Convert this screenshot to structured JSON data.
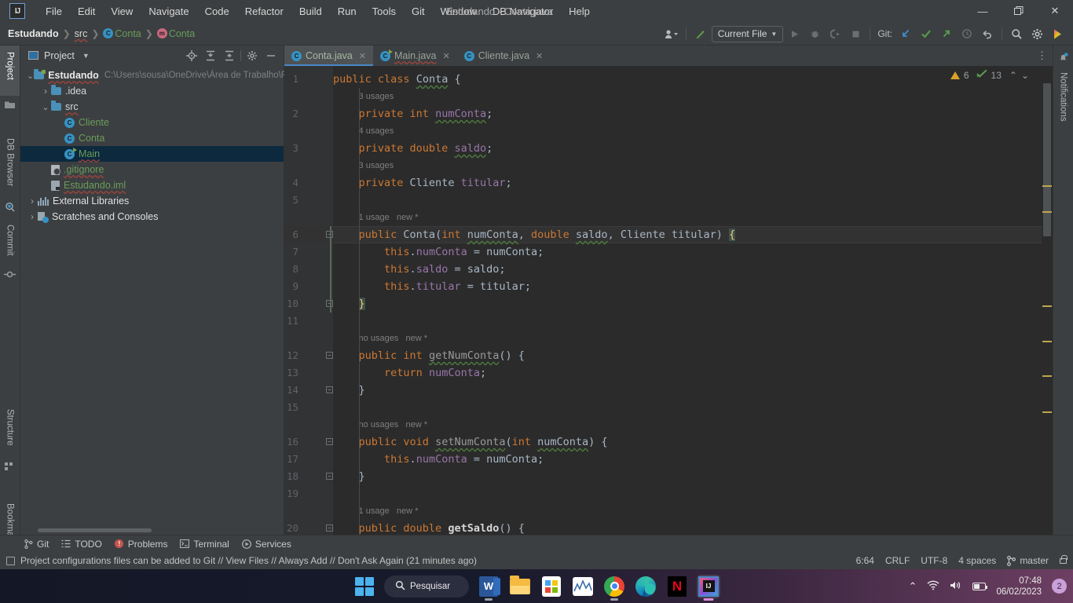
{
  "window": {
    "title": "Estudando - Conta.java",
    "minimize": "—",
    "maximize": "❐",
    "close": "✕"
  },
  "menubar": [
    {
      "label": "File"
    },
    {
      "label": "Edit"
    },
    {
      "label": "View"
    },
    {
      "label": "Navigate"
    },
    {
      "label": "Code"
    },
    {
      "label": "Refactor"
    },
    {
      "label": "Build"
    },
    {
      "label": "Run"
    },
    {
      "label": "Tools"
    },
    {
      "label": "Git"
    },
    {
      "label": "Window"
    },
    {
      "label": "DB Navigator"
    },
    {
      "label": "Help"
    }
  ],
  "breadcrumb": [
    {
      "label": "Estudando",
      "icon": "none"
    },
    {
      "label": "src",
      "icon": "none"
    },
    {
      "label": "Conta",
      "icon": "class-icon"
    },
    {
      "label": "Conta",
      "icon": "method-icon"
    }
  ],
  "toolbar": {
    "profile_icon": "user-icon",
    "hammer_icon": "build-icon",
    "run_config": "Current File",
    "run_icon": "run-icon",
    "debug_icon": "debug-icon",
    "coverage_icon": "run-coverage-icon",
    "stop_icon": "stop-icon",
    "git_label": "Git:",
    "update_icon": "update-project-icon",
    "commit_icon": "commit-checkmark-icon",
    "push_icon": "push-icon",
    "history_icon": "history-icon",
    "rollback_icon": "rollback-icon",
    "search_icon": "search-everywhere-icon",
    "settings_icon": "gear-icon",
    "ai_icon": "ai-assistant-icon"
  },
  "left_stripe": [
    {
      "label": "Project",
      "icon": "project-icon",
      "active": true
    },
    {
      "label": "DB Browser",
      "icon": "db-browser-icon",
      "active": false
    },
    {
      "label": "Commit",
      "icon": "commit-icon",
      "active": false
    },
    {
      "label": "Structure",
      "icon": "structure-icon",
      "active": false
    },
    {
      "label": "Bookmarks",
      "icon": "bookmark-icon",
      "active": false
    }
  ],
  "right_stripe": [
    {
      "label": "Notifications",
      "icon": "bell-icon"
    }
  ],
  "project_panel": {
    "title": "Project",
    "tools": [
      "locate-icon",
      "expand-all-icon",
      "collapse-all-icon",
      "gear-icon",
      "hide-icon"
    ],
    "tree": [
      {
        "label": "Estudando",
        "path": "C:\\Users\\sousa\\OneDrive\\Área de Trabalho\\F",
        "icon": "project-folder-icon",
        "indent": 0,
        "arrow": "down",
        "style": "bold",
        "selected": false
      },
      {
        "label": ".idea",
        "path": "",
        "icon": "folder-icon",
        "indent": 1,
        "arrow": "right",
        "style": "plain",
        "selected": false
      },
      {
        "label": "src",
        "path": "",
        "icon": "folder-icon",
        "indent": 1,
        "arrow": "down",
        "style": "plain",
        "selected": false
      },
      {
        "label": "Cliente",
        "path": "",
        "icon": "java-class-icon",
        "indent": 2,
        "arrow": "none",
        "style": "green",
        "selected": false
      },
      {
        "label": "Conta",
        "path": "",
        "icon": "java-class-icon",
        "indent": 2,
        "arrow": "none",
        "style": "green",
        "selected": false
      },
      {
        "label": "Main",
        "path": "",
        "icon": "java-runnable-class-icon",
        "indent": 2,
        "arrow": "none",
        "style": "green",
        "selected": true
      },
      {
        "label": ".gitignore",
        "path": "",
        "icon": "gitignore-file-icon",
        "indent": 1,
        "arrow": "none",
        "style": "green",
        "selected": false
      },
      {
        "label": "Estudando.iml",
        "path": "",
        "icon": "iml-file-icon",
        "indent": 1,
        "arrow": "none",
        "style": "green",
        "selected": false
      },
      {
        "label": "External Libraries",
        "path": "",
        "icon": "libraries-icon",
        "indent": 0,
        "arrow": "right",
        "style": "white",
        "selected": false
      },
      {
        "label": "Scratches and Consoles",
        "path": "",
        "icon": "scratches-icon",
        "indent": 0,
        "arrow": "right",
        "style": "white",
        "selected": false
      }
    ]
  },
  "editor": {
    "tabs": [
      {
        "label": "Conta.java",
        "icon": "java-class-icon",
        "active": true,
        "close": "✕"
      },
      {
        "label": "Main.java",
        "icon": "java-runnable-class-icon",
        "active": false,
        "close": "✕"
      },
      {
        "label": "Cliente.java",
        "icon": "java-class-icon",
        "active": false,
        "close": "✕"
      }
    ],
    "tabs_more": "⋮",
    "inspections": {
      "warning_icon": "warning-triangle-icon",
      "warning_count": "6",
      "check_icon": "inspection-check-icon",
      "check_count": "13",
      "prev_icon": "⌃",
      "next_icon": "⌄"
    },
    "current_line": 6,
    "lines": [
      {
        "n": "1",
        "indent": 0,
        "tokens": [
          {
            "t": "public ",
            "c": "kw"
          },
          {
            "t": "class ",
            "c": "kw"
          },
          {
            "t": "Conta",
            "c": "ty warnsq"
          },
          {
            "t": " {",
            "c": "pln"
          }
        ]
      },
      {
        "n": "",
        "hint": "3 usages",
        "indent": 4
      },
      {
        "n": "2",
        "indent": 4,
        "tokens": [
          {
            "t": "private ",
            "c": "kw"
          },
          {
            "t": "int ",
            "c": "kw"
          },
          {
            "t": "numConta",
            "c": "fld warnsq"
          },
          {
            "t": ";",
            "c": "pln"
          }
        ]
      },
      {
        "n": "",
        "hint": "4 usages",
        "indent": 4
      },
      {
        "n": "3",
        "indent": 4,
        "tokens": [
          {
            "t": "private ",
            "c": "kw"
          },
          {
            "t": "double ",
            "c": "kw"
          },
          {
            "t": "saldo",
            "c": "fld warnsq"
          },
          {
            "t": ";",
            "c": "pln"
          }
        ]
      },
      {
        "n": "",
        "hint": "3 usages",
        "indent": 4
      },
      {
        "n": "4",
        "indent": 4,
        "tokens": [
          {
            "t": "private ",
            "c": "kw"
          },
          {
            "t": "Cliente ",
            "c": "ty"
          },
          {
            "t": "titular",
            "c": "fld"
          },
          {
            "t": ";",
            "c": "pln"
          }
        ]
      },
      {
        "n": "5",
        "indent": 0,
        "tokens": []
      },
      {
        "n": "",
        "hint": "1 usage   new *",
        "indent": 4
      },
      {
        "n": "6",
        "indent": 4,
        "fold": "minus",
        "tokens": [
          {
            "t": "public ",
            "c": "kw"
          },
          {
            "t": "Conta",
            "c": "ty"
          },
          {
            "t": "(",
            "c": "pln"
          },
          {
            "t": "int ",
            "c": "kw"
          },
          {
            "t": "numConta",
            "c": "pln warnsq"
          },
          {
            "t": ", ",
            "c": "pln"
          },
          {
            "t": "double ",
            "c": "kw"
          },
          {
            "t": "saldo",
            "c": "pln warnsq"
          },
          {
            "t": ", ",
            "c": "pln"
          },
          {
            "t": "Cliente ",
            "c": "ty"
          },
          {
            "t": "titular",
            "c": "pln"
          },
          {
            "t": ") ",
            "c": "pln"
          },
          {
            "t": "{",
            "c": "brace-hl"
          }
        ]
      },
      {
        "n": "7",
        "indent": 8,
        "tokens": [
          {
            "t": "this",
            "c": "kw"
          },
          {
            "t": ".",
            "c": "pln"
          },
          {
            "t": "numConta",
            "c": "fld"
          },
          {
            "t": " = ",
            "c": "pln"
          },
          {
            "t": "numConta",
            "c": "pln"
          },
          {
            "t": ";",
            "c": "pln"
          }
        ]
      },
      {
        "n": "8",
        "indent": 8,
        "tokens": [
          {
            "t": "this",
            "c": "kw"
          },
          {
            "t": ".",
            "c": "pln"
          },
          {
            "t": "saldo",
            "c": "fld"
          },
          {
            "t": " = ",
            "c": "pln"
          },
          {
            "t": "saldo",
            "c": "pln"
          },
          {
            "t": ";",
            "c": "pln"
          }
        ]
      },
      {
        "n": "9",
        "indent": 8,
        "tokens": [
          {
            "t": "this",
            "c": "kw"
          },
          {
            "t": ".",
            "c": "pln"
          },
          {
            "t": "titular",
            "c": "fld"
          },
          {
            "t": " = ",
            "c": "pln"
          },
          {
            "t": "titular",
            "c": "pln"
          },
          {
            "t": ";",
            "c": "pln"
          }
        ]
      },
      {
        "n": "10",
        "indent": 4,
        "fold": "plus",
        "tokens": [
          {
            "t": "}",
            "c": "brace-hl"
          }
        ]
      },
      {
        "n": "11",
        "indent": 0,
        "tokens": []
      },
      {
        "n": "",
        "hint": "no usages   new *",
        "indent": 4
      },
      {
        "n": "12",
        "indent": 4,
        "fold": "minus",
        "tokens": [
          {
            "t": "public ",
            "c": "kw"
          },
          {
            "t": "int ",
            "c": "kw"
          },
          {
            "t": "getNumConta",
            "c": "mth warnsq"
          },
          {
            "t": "() {",
            "c": "pln"
          }
        ]
      },
      {
        "n": "13",
        "indent": 8,
        "tokens": [
          {
            "t": "return ",
            "c": "kw"
          },
          {
            "t": "numConta",
            "c": "fld"
          },
          {
            "t": ";",
            "c": "pln"
          }
        ]
      },
      {
        "n": "14",
        "indent": 4,
        "fold": "plus",
        "tokens": [
          {
            "t": "}",
            "c": "pln"
          }
        ]
      },
      {
        "n": "15",
        "indent": 0,
        "tokens": []
      },
      {
        "n": "",
        "hint": "no usages   new *",
        "indent": 4
      },
      {
        "n": "16",
        "indent": 4,
        "fold": "minus",
        "tokens": [
          {
            "t": "public ",
            "c": "kw"
          },
          {
            "t": "void ",
            "c": "kw"
          },
          {
            "t": "setNumConta",
            "c": "mth warnsq"
          },
          {
            "t": "(",
            "c": "pln"
          },
          {
            "t": "int ",
            "c": "kw"
          },
          {
            "t": "numConta",
            "c": "pln warnsq"
          },
          {
            "t": ") {",
            "c": "pln"
          }
        ]
      },
      {
        "n": "17",
        "indent": 8,
        "tokens": [
          {
            "t": "this",
            "c": "kw"
          },
          {
            "t": ".",
            "c": "pln"
          },
          {
            "t": "numConta",
            "c": "fld"
          },
          {
            "t": " = ",
            "c": "pln"
          },
          {
            "t": "numConta",
            "c": "pln"
          },
          {
            "t": ";",
            "c": "pln"
          }
        ]
      },
      {
        "n": "18",
        "indent": 4,
        "fold": "plus",
        "tokens": [
          {
            "t": "}",
            "c": "pln"
          }
        ]
      },
      {
        "n": "19",
        "indent": 0,
        "tokens": []
      },
      {
        "n": "",
        "hint": "1 usage   new *",
        "indent": 4
      },
      {
        "n": "20",
        "indent": 4,
        "fold": "minus",
        "tokens": [
          {
            "t": "public ",
            "c": "kw"
          },
          {
            "t": "double ",
            "c": "kw"
          },
          {
            "t": "getSaldo",
            "c": "bold-m warnsq"
          },
          {
            "t": "() {",
            "c": "pln"
          }
        ]
      }
    ]
  },
  "bottom_bar": [
    {
      "label": "Git",
      "icon": "git-branch-icon"
    },
    {
      "label": "TODO",
      "icon": "todo-list-icon"
    },
    {
      "label": "Problems",
      "icon": "problems-error-icon"
    },
    {
      "label": "Terminal",
      "icon": "terminal-icon"
    },
    {
      "label": "Services",
      "icon": "services-play-icon"
    }
  ],
  "status_bar": {
    "message_icon": "notification-icon",
    "message": "Project configurations files can be added to Git // View Files // Always Add // Don't Ask Again (21 minutes ago)",
    "caret": "6:64",
    "line_separator": "CRLF",
    "encoding": "UTF-8",
    "indent": "4 spaces",
    "branch_icon": "git-branch-icon",
    "branch": "master",
    "lock_icon": "lock-open-icon"
  },
  "taskbar": {
    "start_icon": "windows-start-icon",
    "search_placeholder": "Pesquisar",
    "search_icon": "search-icon",
    "apps": [
      {
        "name": "word-icon",
        "label": "W",
        "running": true
      },
      {
        "name": "file-explorer-icon",
        "label": "",
        "running": false
      },
      {
        "name": "microsoft-store-icon",
        "label": "",
        "running": false
      },
      {
        "name": "graph-app-icon",
        "label": "",
        "running": false
      },
      {
        "name": "chrome-icon",
        "label": "",
        "running": true
      },
      {
        "name": "edge-icon",
        "label": "",
        "running": false
      },
      {
        "name": "netflix-icon",
        "label": "N",
        "running": false
      },
      {
        "name": "intellij-idea-icon",
        "label": "IJ",
        "running": true
      }
    ],
    "tray": {
      "chevron_icon": "⌃",
      "wifi_icon": "wifi-icon",
      "volume_icon": "volume-icon",
      "battery_icon": "battery-icon",
      "time": "07:48",
      "date": "06/02/2023",
      "notification_count": "2"
    }
  },
  "colors": {
    "accent": "#4a88c7",
    "keyword": "#cc7832",
    "field": "#9876aa",
    "plain": "#a9b7c6",
    "panel": "#3c3f41",
    "editor_bg": "#2b2b2b",
    "selection": "#0d293e"
  }
}
